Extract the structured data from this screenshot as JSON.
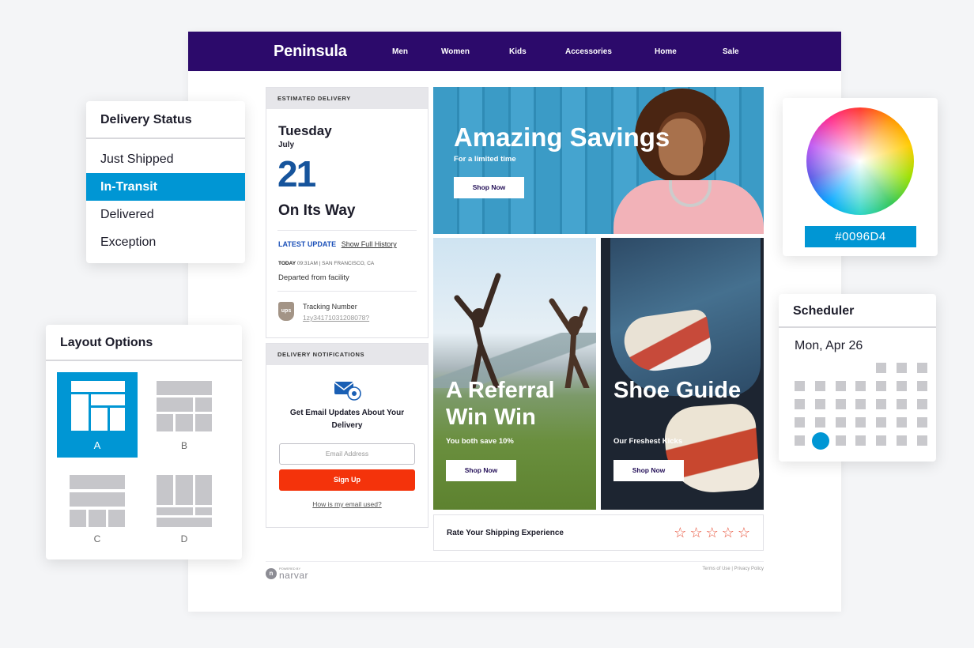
{
  "page": {
    "brand": "Peninsula",
    "nav": [
      "Men",
      "Women",
      "Kids",
      "Accessories",
      "Home",
      "Sale"
    ],
    "delivery": {
      "header": "ESTIMATED DELIVERY",
      "day": "Tuesday",
      "month": "July",
      "date": "21",
      "status": "On Its Way",
      "latest_update_label": "LATEST UPDATE",
      "full_history_link": "Show Full History",
      "today_label": "TODAY",
      "today_detail": "09:31AM | SAN FRANCISCO, CA",
      "event": "Departed from facility",
      "carrier_logo": "ups",
      "tracking_label": "Tracking Number",
      "tracking_number": "1zy34171031208078?"
    },
    "notifications": {
      "header": "DELIVERY NOTIFICATIONS",
      "icon": "email-icon",
      "title": "Get Email Updates About Your Delivery",
      "email_placeholder": "Email Address",
      "signup_label": "Sign Up",
      "help_link": "How is my email used?"
    },
    "heroes": [
      {
        "title": "Amazing Savings",
        "subtitle": "For a limited time",
        "button": "Shop Now"
      },
      {
        "title": "A Referral Win Win",
        "subtitle": "You both save 10%",
        "button": "Shop Now"
      },
      {
        "title": "Shoe Guide",
        "subtitle": "Our Freshest Kicks",
        "button": "Shop Now"
      }
    ],
    "rating": {
      "label": "Rate Your Shipping Experience",
      "stars": 5,
      "star_glyph": "☆"
    },
    "footer": {
      "powered_by": "POWERED BY",
      "logo_text": "narvar",
      "legal": "Terms of Use  |  Privacy Policy"
    }
  },
  "delivery_status_widget": {
    "title": "Delivery Status",
    "items": [
      "Just Shipped",
      "In-Transit",
      "Delivered",
      "Exception"
    ],
    "selected": "In-Transit"
  },
  "layout_widget": {
    "title": "Layout Options",
    "options": [
      "A",
      "B",
      "C",
      "D"
    ],
    "selected": "A"
  },
  "color_widget": {
    "hex": "#0096D4"
  },
  "scheduler_widget": {
    "title": "Scheduler",
    "date": "Mon, Apr 26"
  },
  "colors": {
    "nav_bg": "#2c0a6b",
    "accent": "#0096d4",
    "signup": "#f4330b",
    "date_blue": "#16549c",
    "star": "#e8543c"
  }
}
